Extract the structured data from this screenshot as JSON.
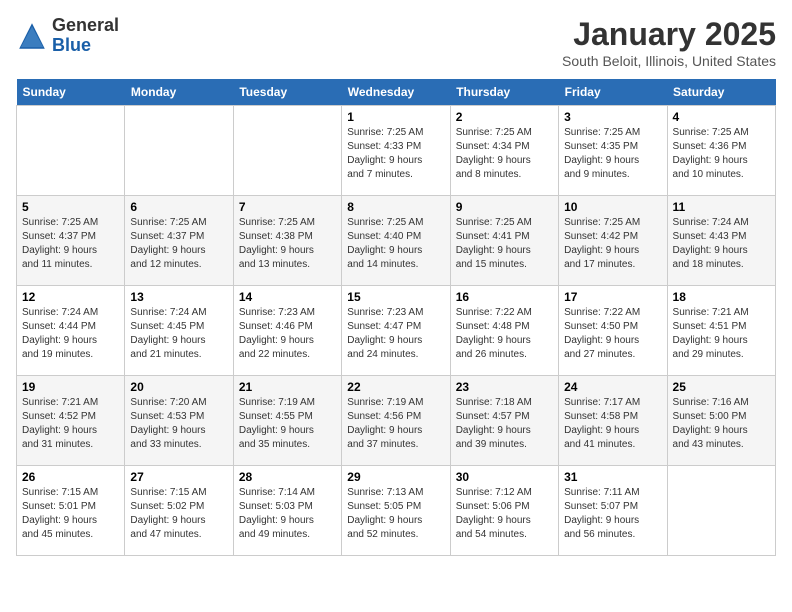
{
  "logo": {
    "general": "General",
    "blue": "Blue"
  },
  "header": {
    "title": "January 2025",
    "subtitle": "South Beloit, Illinois, United States"
  },
  "days_of_week": [
    "Sunday",
    "Monday",
    "Tuesday",
    "Wednesday",
    "Thursday",
    "Friday",
    "Saturday"
  ],
  "weeks": [
    [
      {
        "day": "",
        "info": ""
      },
      {
        "day": "",
        "info": ""
      },
      {
        "day": "",
        "info": ""
      },
      {
        "day": "1",
        "info": "Sunrise: 7:25 AM\nSunset: 4:33 PM\nDaylight: 9 hours\nand 7 minutes."
      },
      {
        "day": "2",
        "info": "Sunrise: 7:25 AM\nSunset: 4:34 PM\nDaylight: 9 hours\nand 8 minutes."
      },
      {
        "day": "3",
        "info": "Sunrise: 7:25 AM\nSunset: 4:35 PM\nDaylight: 9 hours\nand 9 minutes."
      },
      {
        "day": "4",
        "info": "Sunrise: 7:25 AM\nSunset: 4:36 PM\nDaylight: 9 hours\nand 10 minutes."
      }
    ],
    [
      {
        "day": "5",
        "info": "Sunrise: 7:25 AM\nSunset: 4:37 PM\nDaylight: 9 hours\nand 11 minutes."
      },
      {
        "day": "6",
        "info": "Sunrise: 7:25 AM\nSunset: 4:37 PM\nDaylight: 9 hours\nand 12 minutes."
      },
      {
        "day": "7",
        "info": "Sunrise: 7:25 AM\nSunset: 4:38 PM\nDaylight: 9 hours\nand 13 minutes."
      },
      {
        "day": "8",
        "info": "Sunrise: 7:25 AM\nSunset: 4:40 PM\nDaylight: 9 hours\nand 14 minutes."
      },
      {
        "day": "9",
        "info": "Sunrise: 7:25 AM\nSunset: 4:41 PM\nDaylight: 9 hours\nand 15 minutes."
      },
      {
        "day": "10",
        "info": "Sunrise: 7:25 AM\nSunset: 4:42 PM\nDaylight: 9 hours\nand 17 minutes."
      },
      {
        "day": "11",
        "info": "Sunrise: 7:24 AM\nSunset: 4:43 PM\nDaylight: 9 hours\nand 18 minutes."
      }
    ],
    [
      {
        "day": "12",
        "info": "Sunrise: 7:24 AM\nSunset: 4:44 PM\nDaylight: 9 hours\nand 19 minutes."
      },
      {
        "day": "13",
        "info": "Sunrise: 7:24 AM\nSunset: 4:45 PM\nDaylight: 9 hours\nand 21 minutes."
      },
      {
        "day": "14",
        "info": "Sunrise: 7:23 AM\nSunset: 4:46 PM\nDaylight: 9 hours\nand 22 minutes."
      },
      {
        "day": "15",
        "info": "Sunrise: 7:23 AM\nSunset: 4:47 PM\nDaylight: 9 hours\nand 24 minutes."
      },
      {
        "day": "16",
        "info": "Sunrise: 7:22 AM\nSunset: 4:48 PM\nDaylight: 9 hours\nand 26 minutes."
      },
      {
        "day": "17",
        "info": "Sunrise: 7:22 AM\nSunset: 4:50 PM\nDaylight: 9 hours\nand 27 minutes."
      },
      {
        "day": "18",
        "info": "Sunrise: 7:21 AM\nSunset: 4:51 PM\nDaylight: 9 hours\nand 29 minutes."
      }
    ],
    [
      {
        "day": "19",
        "info": "Sunrise: 7:21 AM\nSunset: 4:52 PM\nDaylight: 9 hours\nand 31 minutes."
      },
      {
        "day": "20",
        "info": "Sunrise: 7:20 AM\nSunset: 4:53 PM\nDaylight: 9 hours\nand 33 minutes."
      },
      {
        "day": "21",
        "info": "Sunrise: 7:19 AM\nSunset: 4:55 PM\nDaylight: 9 hours\nand 35 minutes."
      },
      {
        "day": "22",
        "info": "Sunrise: 7:19 AM\nSunset: 4:56 PM\nDaylight: 9 hours\nand 37 minutes."
      },
      {
        "day": "23",
        "info": "Sunrise: 7:18 AM\nSunset: 4:57 PM\nDaylight: 9 hours\nand 39 minutes."
      },
      {
        "day": "24",
        "info": "Sunrise: 7:17 AM\nSunset: 4:58 PM\nDaylight: 9 hours\nand 41 minutes."
      },
      {
        "day": "25",
        "info": "Sunrise: 7:16 AM\nSunset: 5:00 PM\nDaylight: 9 hours\nand 43 minutes."
      }
    ],
    [
      {
        "day": "26",
        "info": "Sunrise: 7:15 AM\nSunset: 5:01 PM\nDaylight: 9 hours\nand 45 minutes."
      },
      {
        "day": "27",
        "info": "Sunrise: 7:15 AM\nSunset: 5:02 PM\nDaylight: 9 hours\nand 47 minutes."
      },
      {
        "day": "28",
        "info": "Sunrise: 7:14 AM\nSunset: 5:03 PM\nDaylight: 9 hours\nand 49 minutes."
      },
      {
        "day": "29",
        "info": "Sunrise: 7:13 AM\nSunset: 5:05 PM\nDaylight: 9 hours\nand 52 minutes."
      },
      {
        "day": "30",
        "info": "Sunrise: 7:12 AM\nSunset: 5:06 PM\nDaylight: 9 hours\nand 54 minutes."
      },
      {
        "day": "31",
        "info": "Sunrise: 7:11 AM\nSunset: 5:07 PM\nDaylight: 9 hours\nand 56 minutes."
      },
      {
        "day": "",
        "info": ""
      }
    ]
  ]
}
